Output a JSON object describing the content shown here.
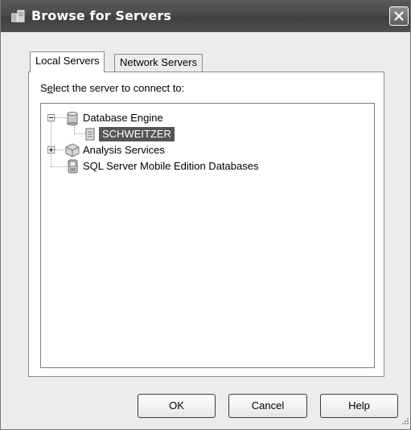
{
  "window": {
    "title": "Browse for Servers",
    "title_icon": "server-browse-icon",
    "close_icon": "close-icon"
  },
  "tabs": [
    {
      "label": "Local Servers",
      "active": true
    },
    {
      "label": "Network Servers",
      "active": false
    }
  ],
  "prompt": {
    "before_accel": "S",
    "accel": "e",
    "after_accel": "lect the server to connect to:"
  },
  "tree": {
    "nodes": [
      {
        "label": "Database Engine",
        "icon": "database-icon",
        "expanded": true,
        "level": 0
      },
      {
        "label": "SCHWEITZER",
        "icon": "server-icon",
        "selected": true,
        "level": 1
      },
      {
        "label": "Analysis Services",
        "icon": "cube-icon",
        "expanded": false,
        "level": 0
      },
      {
        "label": "SQL Server Mobile Edition Databases",
        "icon": "mobile-db-icon",
        "level": 0
      }
    ]
  },
  "buttons": {
    "ok": "OK",
    "cancel": "Cancel",
    "help": "Help"
  },
  "colors": {
    "titlebar": "#4a4a4a",
    "selection": "#555555",
    "dialog_bg": "#ececec"
  }
}
